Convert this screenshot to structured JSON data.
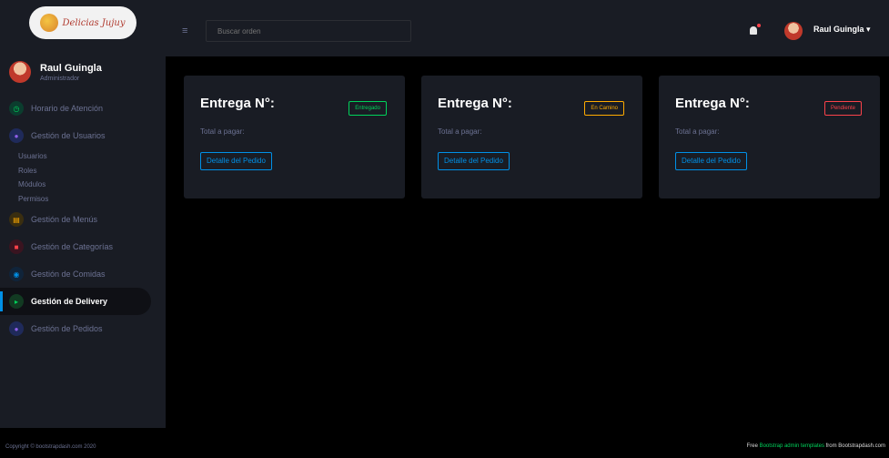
{
  "brand": {
    "logo_text": "Delicias Jujuy"
  },
  "profile": {
    "name": "Raul Guingla",
    "role": "Administrador"
  },
  "sidebar": {
    "items": [
      {
        "label": "Horario de Atención",
        "icon": "clock-icon"
      },
      {
        "label": "Gestión de Usuarios",
        "icon": "users-icon",
        "sub": [
          "Usuarios",
          "Roles",
          "Módulos",
          "Permisos"
        ]
      },
      {
        "label": "Gestión de Menús",
        "icon": "menu-icon"
      },
      {
        "label": "Gestión de Categorías",
        "icon": "category-icon"
      },
      {
        "label": "Gestión de Comidas",
        "icon": "food-icon"
      },
      {
        "label": "Gestión de Delivery",
        "icon": "delivery-icon",
        "active": true
      },
      {
        "label": "Gestión de Pedidos",
        "icon": "orders-icon"
      }
    ]
  },
  "topbar": {
    "search_placeholder": "Buscar orden",
    "user_name": "Raul Guingla ▾"
  },
  "cards": [
    {
      "title": "Entrega N°:",
      "status": "Entregado",
      "subtitle": "Total a pagar:",
      "button": "Detalle del Pedido"
    },
    {
      "title": "Entrega N°:",
      "status": "En Camino",
      "subtitle": "Total a pagar:",
      "button": "Detalle del Pedido"
    },
    {
      "title": "Entrega N°:",
      "status": "Pendiente",
      "subtitle": "Total a pagar:",
      "button": "Detalle del Pedido"
    }
  ],
  "footer": {
    "copyright": "Copyright © bootstrapdash.com 2020",
    "credit_prefix": "Free ",
    "credit_link": "Bootstrap admin templates",
    "credit_suffix": " from Bootstrapdash.com"
  },
  "colors": {
    "sidebar_bg": "#191c24",
    "page_bg": "#000000",
    "success": "#00d25b",
    "warning": "#ffab00",
    "danger": "#fc424a",
    "primary": "#0090e7"
  }
}
